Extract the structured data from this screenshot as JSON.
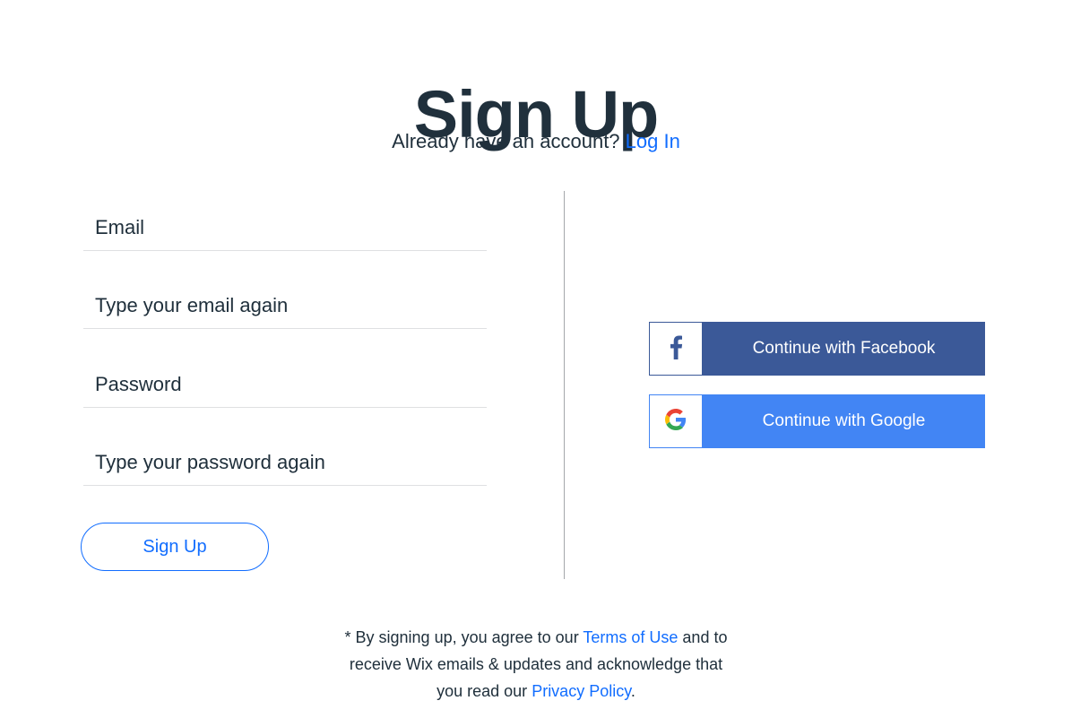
{
  "header": {
    "title": "Sign Up",
    "subtitle_text": "Already have an account?",
    "login_link": "Log In"
  },
  "form": {
    "fields": [
      {
        "name": "email",
        "placeholder": "Email",
        "value": ""
      },
      {
        "name": "email-confirm",
        "placeholder": "Type your email again",
        "value": ""
      },
      {
        "name": "password",
        "placeholder": "Password",
        "value": ""
      },
      {
        "name": "password-confirm",
        "placeholder": "Type your password again",
        "value": ""
      }
    ],
    "submit_label": "Sign Up"
  },
  "social": {
    "facebook": {
      "label": "Continue with Facebook",
      "icon": "facebook-icon",
      "color": "#3b5998"
    },
    "google": {
      "label": "Continue with Google",
      "icon": "google-icon",
      "color": "#4285f4"
    }
  },
  "legal": {
    "line1_prefix": "* By signing up, you agree to our",
    "terms_link": "Terms of Use",
    "line1_suffix": "and to",
    "line2": "receive Wix emails & updates and acknowledge that",
    "line3_prefix": "you read our",
    "privacy_link": "Privacy Policy",
    "line3_suffix": "."
  },
  "colors": {
    "text": "#20303c",
    "link": "#116dff"
  }
}
